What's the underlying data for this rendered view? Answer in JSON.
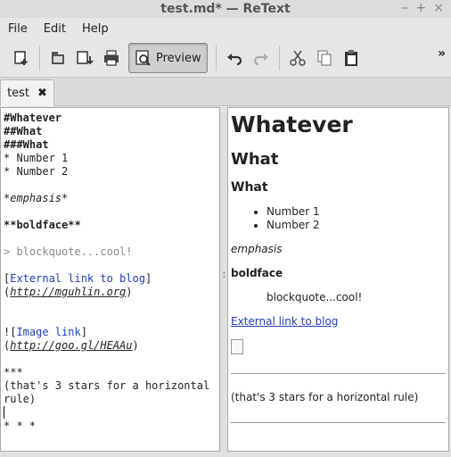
{
  "window": {
    "title": "test.md* — ReText"
  },
  "menu": [
    "File",
    "Edit",
    "Help"
  ],
  "toolbar": {
    "preview_label": "Preview",
    "overflow": "»"
  },
  "tab": {
    "label": "test",
    "close": "✖"
  },
  "editor": {
    "h1": "#Whatever",
    "h2": "##What",
    "h3": "###What",
    "list1": "* Number 1",
    "list2": "* Number 2",
    "em": "*emphasis*",
    "bold": "**boldface**",
    "quote": "> blockquote...cool!",
    "link_open": "[",
    "link_text": "External link to blog",
    "link_close": "]",
    "link_paren_open": "(",
    "link_url": "http://mguhlin.org",
    "link_paren_close": ")",
    "img_open": "![",
    "img_text": "Image link",
    "img_close": "]",
    "img_paren_open": "(",
    "img_url": "http://goo.gl/HEAAu",
    "img_paren_close": ")",
    "hr_md": "***",
    "hr_note1": "(that's 3 stars for a horizontal",
    "hr_note2": "rule)",
    "hr_md2": "* * *"
  },
  "preview": {
    "h1": "Whatever",
    "h2": "What",
    "h3": "What",
    "list": [
      "Number 1",
      "Number 2"
    ],
    "em": "emphasis",
    "bold": "boldface",
    "quote": "blockquote...cool!",
    "link": "External link to blog",
    "hr_note": "(that's 3 stars for a horizontal rule)"
  }
}
